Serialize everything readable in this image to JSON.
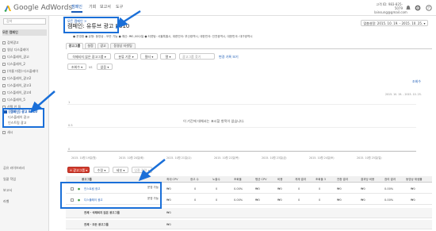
{
  "app": {
    "logo_text": "Google AdWords"
  },
  "nav": {
    "tabs": [
      "캠페인",
      "기회",
      "보고서",
      "도구"
    ],
    "active": 0
  },
  "account": {
    "line1": "고객 ID: 983-825-5079",
    "line2": "lainsung@gmail.com"
  },
  "sidebar": {
    "search_placeholder": "검색",
    "all_campaigns": "모든 캠페인",
    "items": [
      "검색광고",
      "영상 디스플레이",
      "디스플레이_광고",
      "디스플레이_2",
      "(이름 미정)-디스플레이",
      "디스플레이_광고2",
      "디스플레이_광고3",
      "디스플레이_광고4",
      "디스플레이_5",
      "선택 안 됨"
    ],
    "selected_campaign": "[캠페인] 광고 8610",
    "sub_items": [
      "디스플레이 광고",
      "인스트림 광고"
    ],
    "last_item": "새시",
    "bottom_links": [
      "공유 라이브러리",
      "일괄 작업",
      "보고서",
      "라벨"
    ]
  },
  "header": {
    "breadcrumb": "모든 캠페인 >",
    "title": "캠페인: 유튜브 광고 8610",
    "status_line": "● 운영중   ● 유형: 동영상 - 모든 기능   ● 예산: ₩1,000/일   ● 타겟팅: 서울특별시, 대한민국: 부산광역시, 대한민국: 인천광역시, 대한민국: 대구광역시",
    "date_range": "맞춤설정: 2015. 10. 19. - 2015. 10. 25."
  },
  "tabs": [
    "광고그룹",
    "설정",
    "광고",
    "동영상 타겟팅"
  ],
  "toolbar": {
    "filter_dropdown": "삭제되지 않은 광고그룹",
    "segment": "분류 기준",
    "filter": "필터",
    "columns": "열",
    "search_placeholder": "광고그룹 찾기",
    "change_history": "변경 기록 보기"
  },
  "chart_controls": {
    "metric1": "조회수",
    "vs": "vs",
    "metric2": "없음"
  },
  "chart": {
    "empty_message": "이 기간에 대해서는 표시할 항목이 없습니다.",
    "right_label": "조회수",
    "right_date": "2015. 10. 19. - 2015. 10. 25.",
    "y_ticks": [
      "1",
      "0.5",
      "0"
    ],
    "x_ticks": [
      "2015. 10월 19일(월)",
      "2015. 10월 20일(화)",
      "2015. 10월 21일(수)",
      "2015. 10월 22일(목)",
      "2015. 10월 23일(금)",
      "2015. 10월 24일(토)",
      "2015. 10월 25일(일)"
    ]
  },
  "actions": {
    "add": "+ 광고그룹",
    "edit": "수정",
    "details": "세부",
    "bid": "입찰 전략"
  },
  "table": {
    "headers": [
      "광고그룹",
      "",
      "최대 CPV",
      "광고 수",
      "노출수",
      "조회율",
      "평균 CPV",
      "비용",
      "게재 결과",
      "조회율 3",
      "전환 결과",
      "결과당 비용",
      "참여 결과",
      "동영상 재생률"
    ],
    "rows": [
      {
        "name": "인스트림 광고",
        "status": "운영 가능",
        "cpv": "₩0",
        "vals": [
          "0",
          "0",
          "0.00%",
          "₩0",
          "₩0",
          "0",
          "0",
          "₩0",
          "₩0",
          "0.00%",
          "₩0"
        ]
      },
      {
        "name": "디스플레이 광고",
        "status": "운영 가능",
        "cpv": "₩0",
        "vals": [
          "0",
          "0",
          "0.00%",
          "₩0",
          "₩0",
          "0",
          "0",
          "₩0",
          "₩0",
          "0.00%",
          "₩0"
        ]
      }
    ],
    "summary": [
      {
        "label": "전체 - 삭제되지 않은 광고그룹",
        "cpv": "₩0"
      },
      {
        "label": "전체 - 모든 광고그룹",
        "cpv": "₩0"
      }
    ]
  }
}
